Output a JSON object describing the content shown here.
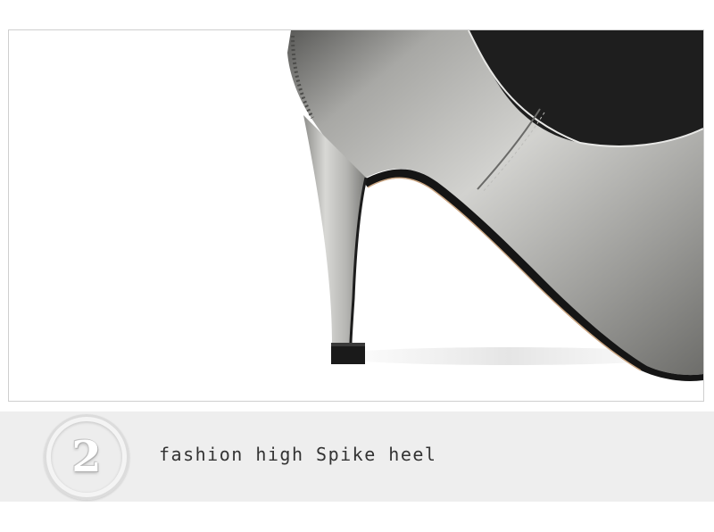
{
  "image": {
    "subject": "high-heel-pump-shoe",
    "colors": {
      "background": "#ffffff",
      "frame_border": "#cfcfcf",
      "leather_light": "#c9c9c7",
      "leather_dark": "#6e6e6c",
      "heel_tip": "#1a1a1a",
      "caption_band": "#eeeeee",
      "caption_text": "#333333"
    }
  },
  "feature": {
    "step_number": "2",
    "caption": "fashion high Spike heel"
  }
}
